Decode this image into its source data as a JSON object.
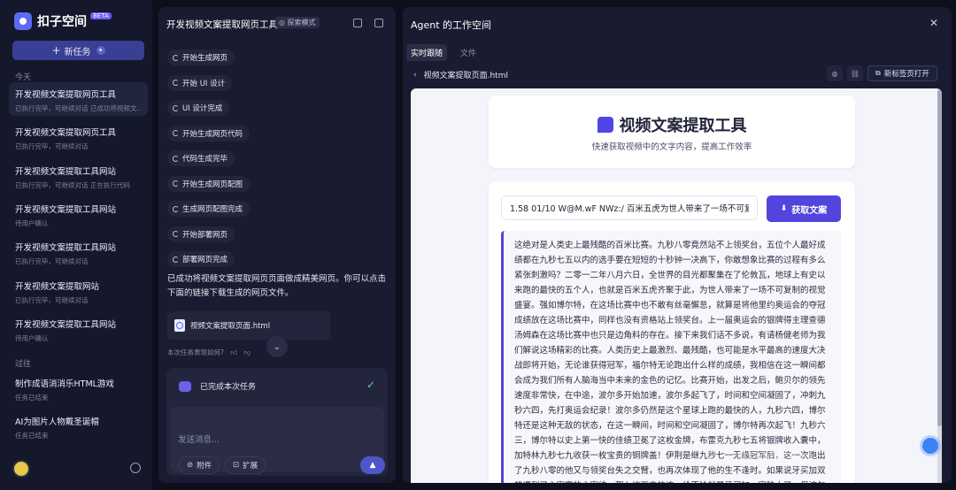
{
  "app": {
    "name": "扣子空间",
    "badge": "BETA"
  },
  "sidebar": {
    "new_task_label": "新任务",
    "today_label": "今天",
    "past_label": "过往",
    "today_tasks": [
      {
        "title": "开发视频文案提取网页工具",
        "sub": "已执行完毕，可继续对话 已成功将视频文..."
      },
      {
        "title": "开发视频文案提取网页工具",
        "sub": "已执行完毕，可继续对话"
      },
      {
        "title": "开发视频文案提取工具网站",
        "sub": "已执行完毕，可继续对话 正在执行代码"
      },
      {
        "title": "开发视频文案提取工具网站",
        "sub": "待用户确认"
      },
      {
        "title": "开发视频文案提取工具网站",
        "sub": "已执行完毕，可继续对话"
      },
      {
        "title": "开发视频文案提取网站",
        "sub": "已执行完毕，可继续对话"
      },
      {
        "title": "开发视频文案提取工具网站",
        "sub": "待用户确认"
      }
    ],
    "past_tasks": [
      {
        "title": "制作成语消消乐HTML游戏",
        "sub": "任务已结束"
      },
      {
        "title": "AI为图片人物戴圣诞帽",
        "sub": "任务已结束"
      }
    ]
  },
  "chat": {
    "title": "开发视频文案提取网页工具",
    "mode_tag": "探索模式",
    "steps": [
      "开始生成网页",
      "开始 UI 设计",
      "UI 设计完成",
      "开始生成网页代码",
      "代码生成完毕",
      "开始生成网页配图",
      "生成网页配图完成",
      "开始部署网页",
      "部署网页完成"
    ],
    "message": "已成功将视频文案提取网页页面做成精美网页。你可以点击下面的链接下载生成的网页文件。",
    "file_name": "视频文案提取页面.html",
    "feedback_label": "本次任务表现如何?",
    "done_label": "已完成本次任务",
    "input_placeholder": "发送消息...",
    "attach_label": "附件",
    "expand_label": "扩展"
  },
  "workspace": {
    "title": "Agent 的工作空间",
    "tabs": [
      "实时跟随",
      "文件"
    ],
    "file_name": "视频文案提取页面.html",
    "open_new_tab_label": "新标签页打开",
    "preview": {
      "title": "视频文案提取工具",
      "subtitle": "快速获取视频中的文字内容，提高工作效率",
      "input_value": "1.58 01/10 W@M.wF NWz:/ 百米五虎为世人带来了一场不可复",
      "fetch_label": "获取文案",
      "result_text": "这绝对是人类史上最残酷的百米比赛。九秒八零竟然站不上领奖台，五位个人最好成绩都在九秒七五以内的选手要在短短的十秒钟一决高下，你敢想象比赛的过程有多么紧张刺激吗？二零一二年八月六日，全世界的目光都聚集在了伦敦瓦，地球上有史以来跑的最快的五个人，也就是百米五虎齐聚于此，为世人带来了一场不可复制的视觉盛宴。强如博尔特，在这场比赛中也不敢有丝毫懈怠，就算是将他里约奥运会的夺冠成绩放在这场比赛中，同样也没有资格站上领奖台。上一届奥运会的银牌得主理查德汤姆森在这场比赛中也只是边角料的存在。接下来我们话不多说，有请杨健老师为我们解说这场精彩的比赛。人类历史上最激烈、最残酷，也可能是水平最高的速度大决战即将开始，无论谁获得冠军，福尔特无论跑出什么样的成绩，我相信在这一瞬间都会成为我们所有人脑海当中未来的金色的记忆。比赛开始，出发之后，鲍贝尔的领先速度非常快，在中途，波尔多开始加速，波尔多起飞了，时间和空间凝固了，冲刺九秒六四，先打奥运会纪录！波尔多仍然是这个星球上跑的最快的人，九秒六四，博尔特还是这种无敌的状态，在这一瞬间，时间和空间凝固了，博尔特再次起飞！九秒六三，博尔特以史上第一快的佳绩卫冕了这枚金牌，布雷克九秒七五将银牌收入囊中，加特林九秒七九收获一枚宝贵的铜牌盖！伊荆是继九秒七一无缘冠军后，这一次跑出了九秒八零的他又与领奖台失之交臂，也再次体现了他的生不逢时。如果说牙买加双雄遇到了主宰赛的主宰律，那么接下来的这一枪不恰就是牙买加一家独大了。但波尔特所面临的挑战却变得更加严峻，因为野哥布雷克不仅在奥运会前夕跑出了十九秒二六的历史第二快成绩，还在奥运会前的牙买加"
    }
  },
  "watermark": "长的AIGC",
  "colors": {
    "accent": "#5245dd",
    "new_task_bg": "#3a3f94",
    "success": "#6fcf8e"
  }
}
